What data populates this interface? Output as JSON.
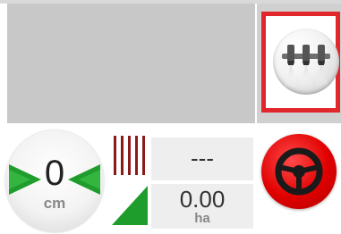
{
  "colors": {
    "accent_red": "#e1262c",
    "guide_green": "#1f9d2c",
    "swath_red": "#8b1a1a",
    "map_gray": "#c8c8c8"
  },
  "boom_section": {
    "icon": "boom-sections-icon",
    "selected": true
  },
  "cross_track": {
    "value": "0",
    "unit": "cm",
    "left_arrow_icon": "left-guide-arrow-icon",
    "right_arrow_icon": "right-guide-arrow-icon"
  },
  "swath": {
    "value": "---",
    "icon": "swath-lines-icon"
  },
  "area": {
    "value": "0.00",
    "unit": "ha",
    "icon": "area-wedge-icon"
  },
  "auto_steer": {
    "icon": "steering-wheel-icon",
    "state": "off"
  }
}
